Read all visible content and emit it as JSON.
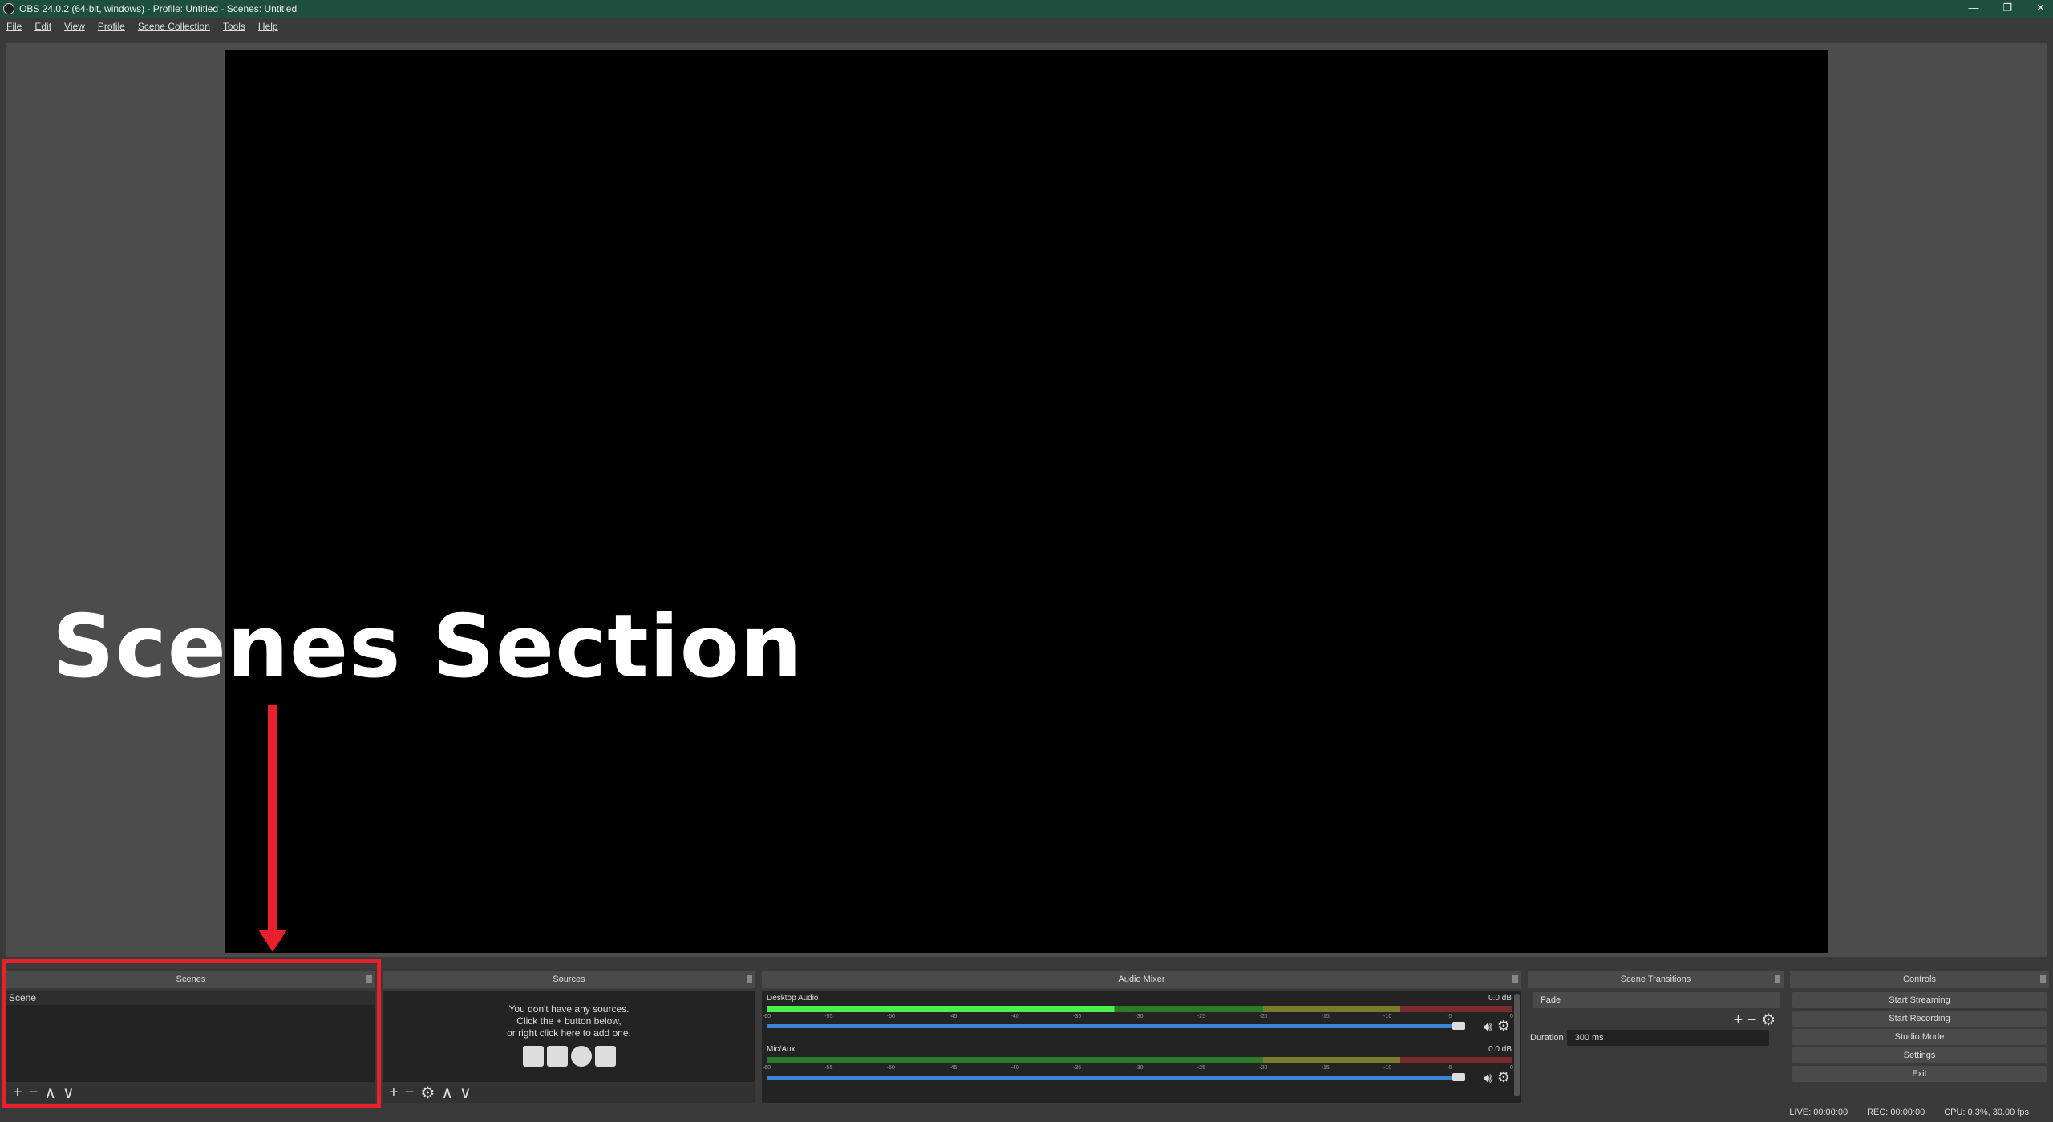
{
  "window": {
    "title": "OBS 24.0.2 (64-bit, windows) - Profile: Untitled - Scenes: Untitled",
    "controls": [
      "—",
      "❐",
      "✕"
    ]
  },
  "menu": [
    "File",
    "Edit",
    "View",
    "Profile",
    "Scene Collection",
    "Tools",
    "Help"
  ],
  "annotation": {
    "label": "Scenes Section",
    "color": "#e8202c"
  },
  "scenes": {
    "title": "Scenes",
    "items": [
      "Scene"
    ],
    "toolbar": [
      "+",
      "−",
      "∧",
      "∨"
    ]
  },
  "sources": {
    "title": "Sources",
    "empty_lines": [
      "You don't have any sources.",
      "Click the + button below,",
      "or right click here to add one."
    ],
    "icons": [
      "image-icon",
      "display-icon",
      "browser-icon",
      "camera-icon"
    ],
    "toolbar": [
      "+",
      "−",
      "⚙",
      "∧",
      "∨"
    ]
  },
  "audio_mixer": {
    "title": "Audio Mixer",
    "ticks": [
      "-60",
      "-55",
      "-50",
      "-45",
      "-40",
      "-35",
      "-30",
      "-25",
      "-20",
      "-15",
      "-10",
      "-5",
      "0"
    ],
    "channels": [
      {
        "name": "Desktop Audio",
        "db": "0.0 dB",
        "level_db": -32,
        "volume_percent": 100
      },
      {
        "name": "Mic/Aux",
        "db": "0.0 dB",
        "level_db": -60,
        "volume_percent": 100
      }
    ]
  },
  "transitions": {
    "title": "Scene Transitions",
    "selected": "Fade",
    "duration_label": "Duration",
    "duration": "300 ms"
  },
  "controls": {
    "title": "Controls",
    "buttons": [
      "Start Streaming",
      "Start Recording",
      "Studio Mode",
      "Settings",
      "Exit"
    ]
  },
  "status": {
    "live": "LIVE: 00:00:00",
    "rec": "REC: 00:00:00",
    "cpu": "CPU: 0.3%, 30.00 fps"
  }
}
